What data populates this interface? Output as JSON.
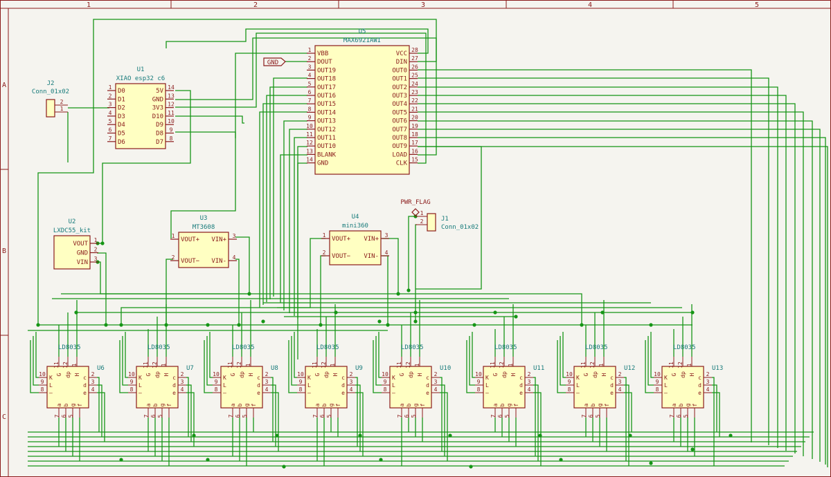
{
  "frame": {
    "col_labels": [
      "1",
      "2",
      "3",
      "4",
      "5"
    ],
    "row_labels": [
      "A",
      "B",
      "C"
    ]
  },
  "colors": {
    "background": "#f5f4ef",
    "frame": "#8a1a1a",
    "body_fill": "#ffffc2",
    "body_stroke": "#8a1a1a",
    "wire": "#159515",
    "ref_text": "#167a7a",
    "value_text": "#167a7a",
    "pin_num": "#8a1a1a",
    "pin_name": "#8a1a1a"
  },
  "components": {
    "U5": {
      "ref": "U5",
      "value": "MAX6921AWI",
      "left_pins": [
        {
          "num": "1",
          "name": "VBB"
        },
        {
          "num": "2",
          "name": "DOUT"
        },
        {
          "num": "3",
          "name": "OUT19"
        },
        {
          "num": "4",
          "name": "OUT18"
        },
        {
          "num": "5",
          "name": "OUT17"
        },
        {
          "num": "6",
          "name": "OUT16"
        },
        {
          "num": "7",
          "name": "OUT15"
        },
        {
          "num": "8",
          "name": "OUT14"
        },
        {
          "num": "9",
          "name": "OUT13"
        },
        {
          "num": "10",
          "name": "OUT12"
        },
        {
          "num": "11",
          "name": "OUT11"
        },
        {
          "num": "12",
          "name": "OUT10"
        },
        {
          "num": "13",
          "name": "BLANK"
        },
        {
          "num": "14",
          "name": "GND"
        }
      ],
      "right_pins": [
        {
          "num": "28",
          "name": "VCC"
        },
        {
          "num": "27",
          "name": "DIN"
        },
        {
          "num": "26",
          "name": "OUT0"
        },
        {
          "num": "25",
          "name": "OUT1"
        },
        {
          "num": "24",
          "name": "OUT2"
        },
        {
          "num": "23",
          "name": "OUT3"
        },
        {
          "num": "22",
          "name": "OUT4"
        },
        {
          "num": "21",
          "name": "OUT5"
        },
        {
          "num": "20",
          "name": "OUT6"
        },
        {
          "num": "19",
          "name": "OUT7"
        },
        {
          "num": "18",
          "name": "OUT8"
        },
        {
          "num": "17",
          "name": "OUT9"
        },
        {
          "num": "16",
          "name": "LOAD"
        },
        {
          "num": "15",
          "name": "CLK"
        }
      ]
    },
    "U1": {
      "ref": "U1",
      "value": "XIAO esp32 c6",
      "left_pins": [
        {
          "num": "1",
          "name": "D0"
        },
        {
          "num": "2",
          "name": "D1"
        },
        {
          "num": "3",
          "name": "D2"
        },
        {
          "num": "4",
          "name": "D3"
        },
        {
          "num": "5",
          "name": "D4"
        },
        {
          "num": "6",
          "name": "D5"
        },
        {
          "num": "7",
          "name": "D6"
        }
      ],
      "right_pins": [
        {
          "num": "14",
          "name": "5V"
        },
        {
          "num": "13",
          "name": "GND"
        },
        {
          "num": "12",
          "name": "3V3"
        },
        {
          "num": "11",
          "name": "D10"
        },
        {
          "num": "10",
          "name": "D9"
        },
        {
          "num": "9",
          "name": "D8"
        },
        {
          "num": "8",
          "name": "D7"
        }
      ]
    },
    "J2": {
      "ref": "J2",
      "value": "Conn_01x02",
      "pins": [
        "2",
        "1"
      ]
    },
    "J1": {
      "ref": "J1",
      "value": "Conn_01x02",
      "pins": [
        "1",
        "2"
      ]
    },
    "U2": {
      "ref": "U2",
      "value": "LXDC55_kit",
      "pins": [
        {
          "num": "1",
          "name": "VOUT"
        },
        {
          "num": "2",
          "name": "GND"
        },
        {
          "num": "3",
          "name": "VIN"
        }
      ]
    },
    "U3": {
      "ref": "U3",
      "value": "MT3608",
      "left_pins": [
        {
          "num": "1",
          "name": "VOUT+"
        },
        {
          "num": "2",
          "name": "VOUT−"
        }
      ],
      "right_pins": [
        {
          "num": "3",
          "name": "VIN+"
        },
        {
          "num": "4",
          "name": "VIN-"
        }
      ]
    },
    "U4": {
      "ref": "U4",
      "value": "mini360",
      "left_pins": [
        {
          "num": "1",
          "name": "VOUT+"
        },
        {
          "num": "2",
          "name": "VOUT−"
        }
      ],
      "right_pins": [
        {
          "num": "3",
          "name": "VIN+"
        },
        {
          "num": "4",
          "name": "VIN-"
        }
      ]
    },
    "GND_label": {
      "text": "GND"
    },
    "PWR_FLAG": {
      "text": "PWR_FLAG"
    }
  },
  "displays": {
    "value": "LD8035",
    "refs": [
      "U6",
      "U7",
      "U8",
      "U9",
      "U10",
      "U11",
      "U12",
      "U13"
    ],
    "top_pins": [
      {
        "num": "11",
        "name": "G"
      },
      {
        "num": "12",
        "name": "dp"
      },
      {
        "num": "1",
        "name": "H"
      }
    ],
    "left_pins": [
      {
        "num": "10",
        "name": "K"
      },
      {
        "num": "9",
        "name": "L"
      },
      {
        "num": "8",
        "name": "—"
      }
    ],
    "right_pins": [
      {
        "num": "2",
        "name": "c"
      },
      {
        "num": "3",
        "name": "d"
      },
      {
        "num": "4",
        "name": "e"
      }
    ],
    "bottom_pins": [
      {
        "num": "7",
        "name": "a"
      },
      {
        "num": "6",
        "name": "b"
      },
      {
        "num": "5",
        "name": "g"
      },
      {
        "num": "",
        "name": "f"
      }
    ]
  }
}
